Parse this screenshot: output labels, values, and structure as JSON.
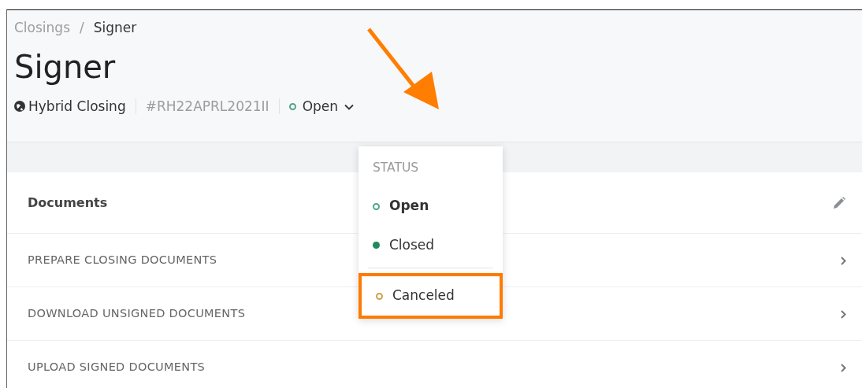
{
  "breadcrumb": [
    {
      "label": "Closings",
      "current": false
    },
    {
      "label": "/",
      "kind": "separator"
    },
    {
      "label": "Signer",
      "current": true
    }
  ],
  "title": "Signer",
  "meta": {
    "closing_type": "Hybrid Closing",
    "reference": "#RH22APRL2021II",
    "status": "Open"
  },
  "status_menu": {
    "heading": "STATUS",
    "items": [
      {
        "label": "Open",
        "kind": "ring",
        "color": "#4fa58a",
        "selected": true,
        "highlighted": false
      },
      {
        "label": "Closed",
        "kind": "dot",
        "color": "#1e8a5e",
        "selected": false,
        "highlighted": false
      },
      {
        "label": "Canceled",
        "kind": "ring",
        "color": "#d0a050",
        "selected": false,
        "highlighted": true,
        "divider_before": true
      }
    ]
  },
  "documents": {
    "title": "Documents",
    "rows": [
      {
        "label": "PREPARE CLOSING DOCUMENTS"
      },
      {
        "label": "DOWNLOAD UNSIGNED DOCUMENTS"
      },
      {
        "label": "UPLOAD SIGNED DOCUMENTS"
      }
    ]
  }
}
